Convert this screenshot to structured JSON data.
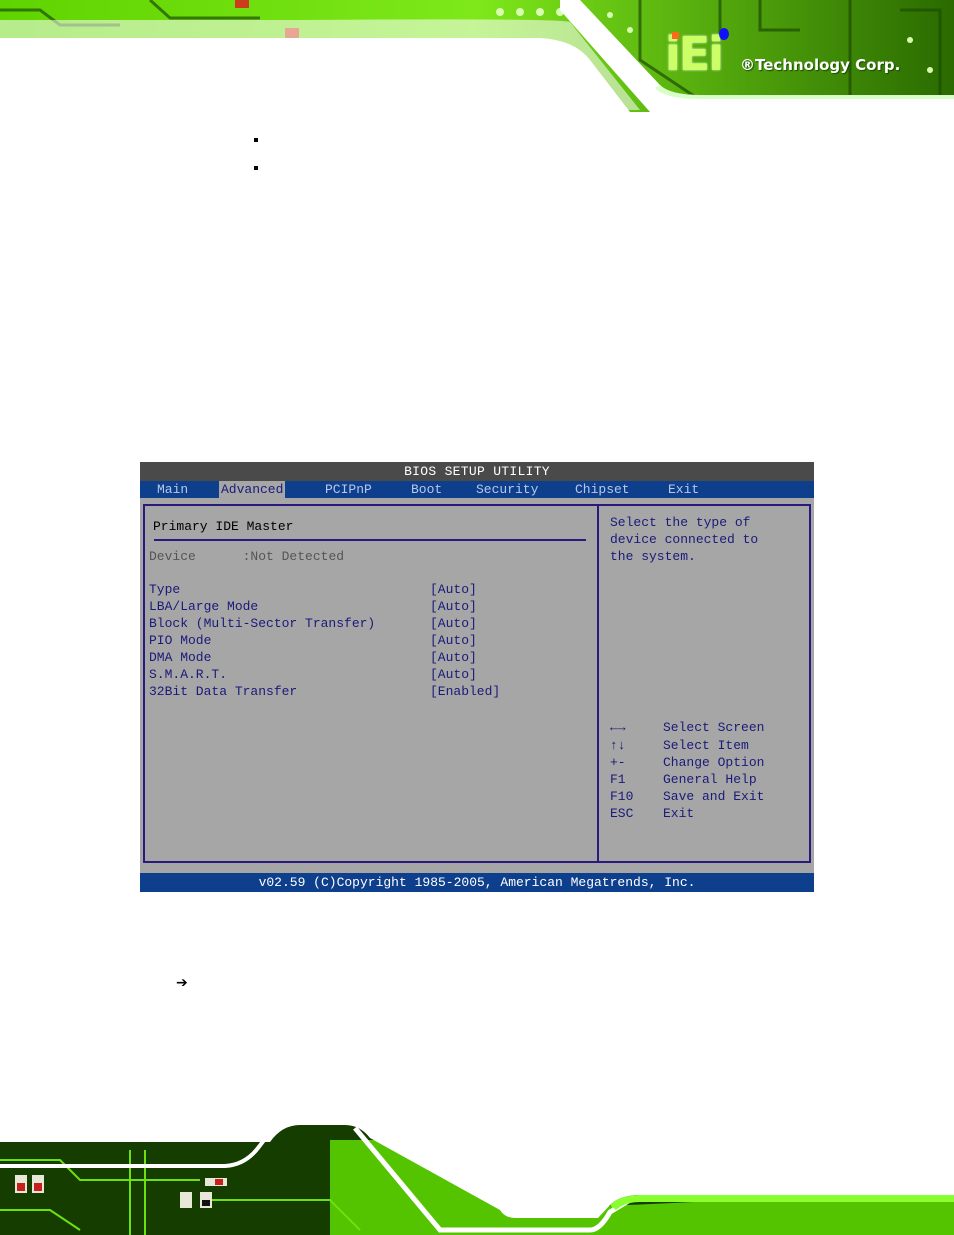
{
  "header": {
    "logo_mark": "iEi",
    "logo_text": "®Technology Corp."
  },
  "bullets": [
    "",
    ""
  ],
  "arrow_icon": "➔",
  "bios": {
    "title": "BIOS SETUP UTILITY",
    "menu": [
      {
        "label": "Main",
        "active": false
      },
      {
        "label": "Advanced",
        "active": true
      },
      {
        "label": "PCIPnP",
        "active": false
      },
      {
        "label": "Boot",
        "active": false
      },
      {
        "label": "Security",
        "active": false
      },
      {
        "label": "Chipset",
        "active": false
      },
      {
        "label": "Exit",
        "active": false
      }
    ],
    "section_title": "Primary IDE Master",
    "device": {
      "label": "Device",
      "value": ":Not Detected"
    },
    "options": [
      {
        "label": "Type",
        "value": "[Auto]"
      },
      {
        "label": "LBA/Large Mode",
        "value": "[Auto]"
      },
      {
        "label": "Block (Multi-Sector Transfer)",
        "value": "[Auto]"
      },
      {
        "label": "PIO Mode",
        "value": "[Auto]"
      },
      {
        "label": "DMA Mode",
        "value": "[Auto]"
      },
      {
        "label": "S.M.A.R.T.",
        "value": "[Auto]"
      },
      {
        "label": "32Bit Data Transfer",
        "value": "[Enabled]"
      }
    ],
    "help_text": "Select the type of\ndevice connected to\nthe system.",
    "keys": [
      {
        "key": "←→",
        "action": "Select Screen"
      },
      {
        "key": "↑↓",
        "action": "Select Item"
      },
      {
        "key": "+-",
        "action": "Change Option"
      },
      {
        "key": "F1",
        "action": "General Help"
      },
      {
        "key": "F10",
        "action": "Save and Exit"
      },
      {
        "key": "ESC",
        "action": "Exit"
      }
    ],
    "footer": "v02.59 (C)Copyright 1985-2005, American Megatrends, Inc.",
    "colors": {
      "title_bar": "#4a4a4a",
      "menu_bar": "#0e3f8c",
      "background": "#a6a6a6",
      "frame": "#2a1a80",
      "text": "#1a1a7a"
    }
  }
}
